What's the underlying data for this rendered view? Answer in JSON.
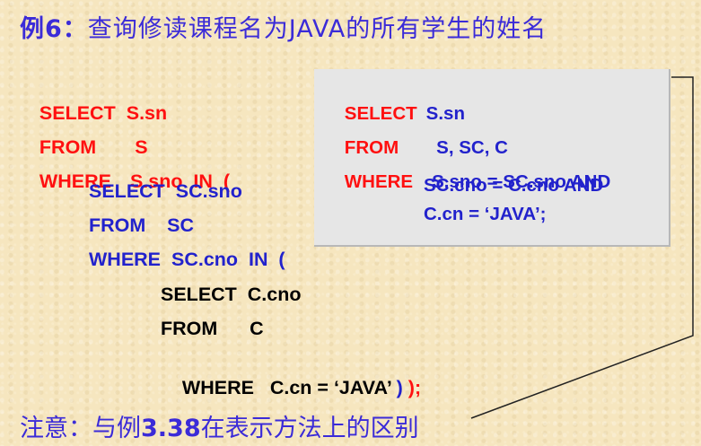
{
  "title": {
    "prefix": "例6：",
    "text": "查询修读课程名为JAVA的所有学生的姓名"
  },
  "nested_query": {
    "l1_kw": "SELECT",
    "l1_rest": "S.sn",
    "l2_kw": "FROM",
    "l2_rest": "S",
    "l3_kw": "WHERE",
    "l3_rest": "S.sno  IN  (",
    "l4": "SELECT  SC.sno",
    "l5": "FROM    SC",
    "l6": "WHERE  SC.cno  IN  (",
    "l7": "SELECT  C.cno",
    "l8": "FROM      C",
    "l9_main": "WHERE   C.cn = ‘JAVA’",
    "l9_close1": " )",
    "l9_close2": " );"
  },
  "join_query": {
    "l1_kw": "SELECT",
    "l1_rest": "S.sn",
    "l2_kw": "FROM",
    "l2_rest": "S, SC, C",
    "l3_kw": "WHERE",
    "l3_rest": "S.sno = SC.sno AND",
    "l4": "SC.cno = C.cno AND",
    "l5": "C.cn = ‘JAVA’;"
  },
  "note": {
    "prefix": "注意：与例",
    "bold": "3.38",
    "suffix": "在表示方法上的区别"
  },
  "colors": {
    "title": "#3b2bd8",
    "keyword_red": "#ff1010",
    "subquery_blue": "#2222cc",
    "box_bg": "#e6e6e6"
  }
}
